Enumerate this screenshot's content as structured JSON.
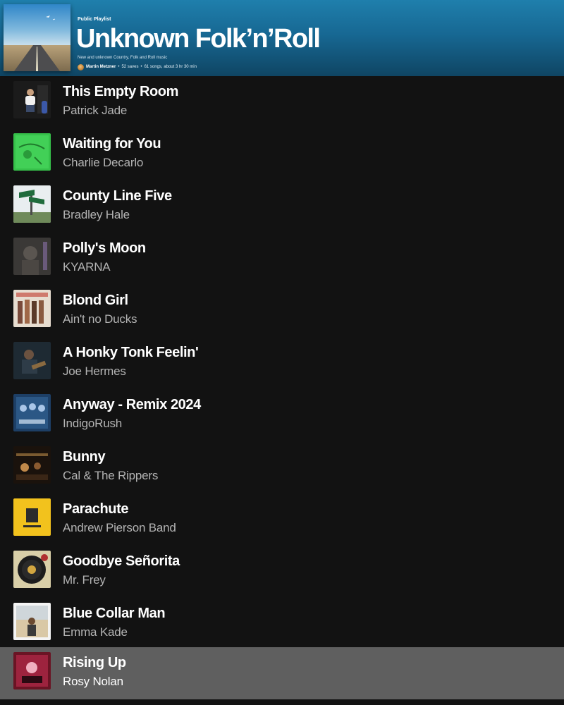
{
  "playlist": {
    "type_label": "Public Playlist",
    "title": "Unknown Folk’n’Roll",
    "description": "New and unknown Country, Folk and Roll music",
    "owner": "Martin Metzner",
    "saves": "52 saves",
    "songs_duration": "61 songs, about 3 hr 30 min",
    "meta_separator": "•",
    "header_gradient": [
      "#1f7fac",
      "#0f4563"
    ]
  },
  "tracks": [
    {
      "title": "This Empty Room",
      "artist": "Patrick Jade",
      "art": "man-on-stool"
    },
    {
      "title": "Waiting for You",
      "artist": "Charlie Decarlo",
      "art": "green-vintage"
    },
    {
      "title": "County Line Five",
      "artist": "Bradley Hale",
      "art": "road-sign"
    },
    {
      "title": "Polly's Moon",
      "artist": "KYARNA",
      "art": "dark-portrait"
    },
    {
      "title": "Blond Girl",
      "artist": "Ain't no Ducks",
      "art": "band-photo"
    },
    {
      "title": "A Honky Tonk Feelin'",
      "artist": "Joe Hermes",
      "art": "guitarist-dark"
    },
    {
      "title": "Anyway - Remix 2024",
      "artist": "IndigoRush",
      "art": "blue-band"
    },
    {
      "title": "Bunny",
      "artist": "Cal & The Rippers",
      "art": "dark-bar"
    },
    {
      "title": "Parachute",
      "artist": "Andrew Pierson Band",
      "art": "yellow-cover"
    },
    {
      "title": "Goodbye Señorita",
      "artist": "Mr. Frey",
      "art": "vinyl-record"
    },
    {
      "title": "Blue Collar Man",
      "artist": "Emma Kade",
      "art": "woman-field"
    },
    {
      "title": "Rising Up",
      "artist": "Rosy Nolan",
      "art": "pink-collage",
      "active": true
    }
  ],
  "colors": {
    "background": "#121212",
    "active_row": "#5f5f5f",
    "title_text": "#ffffff",
    "artist_text": "#b3b3b3"
  }
}
